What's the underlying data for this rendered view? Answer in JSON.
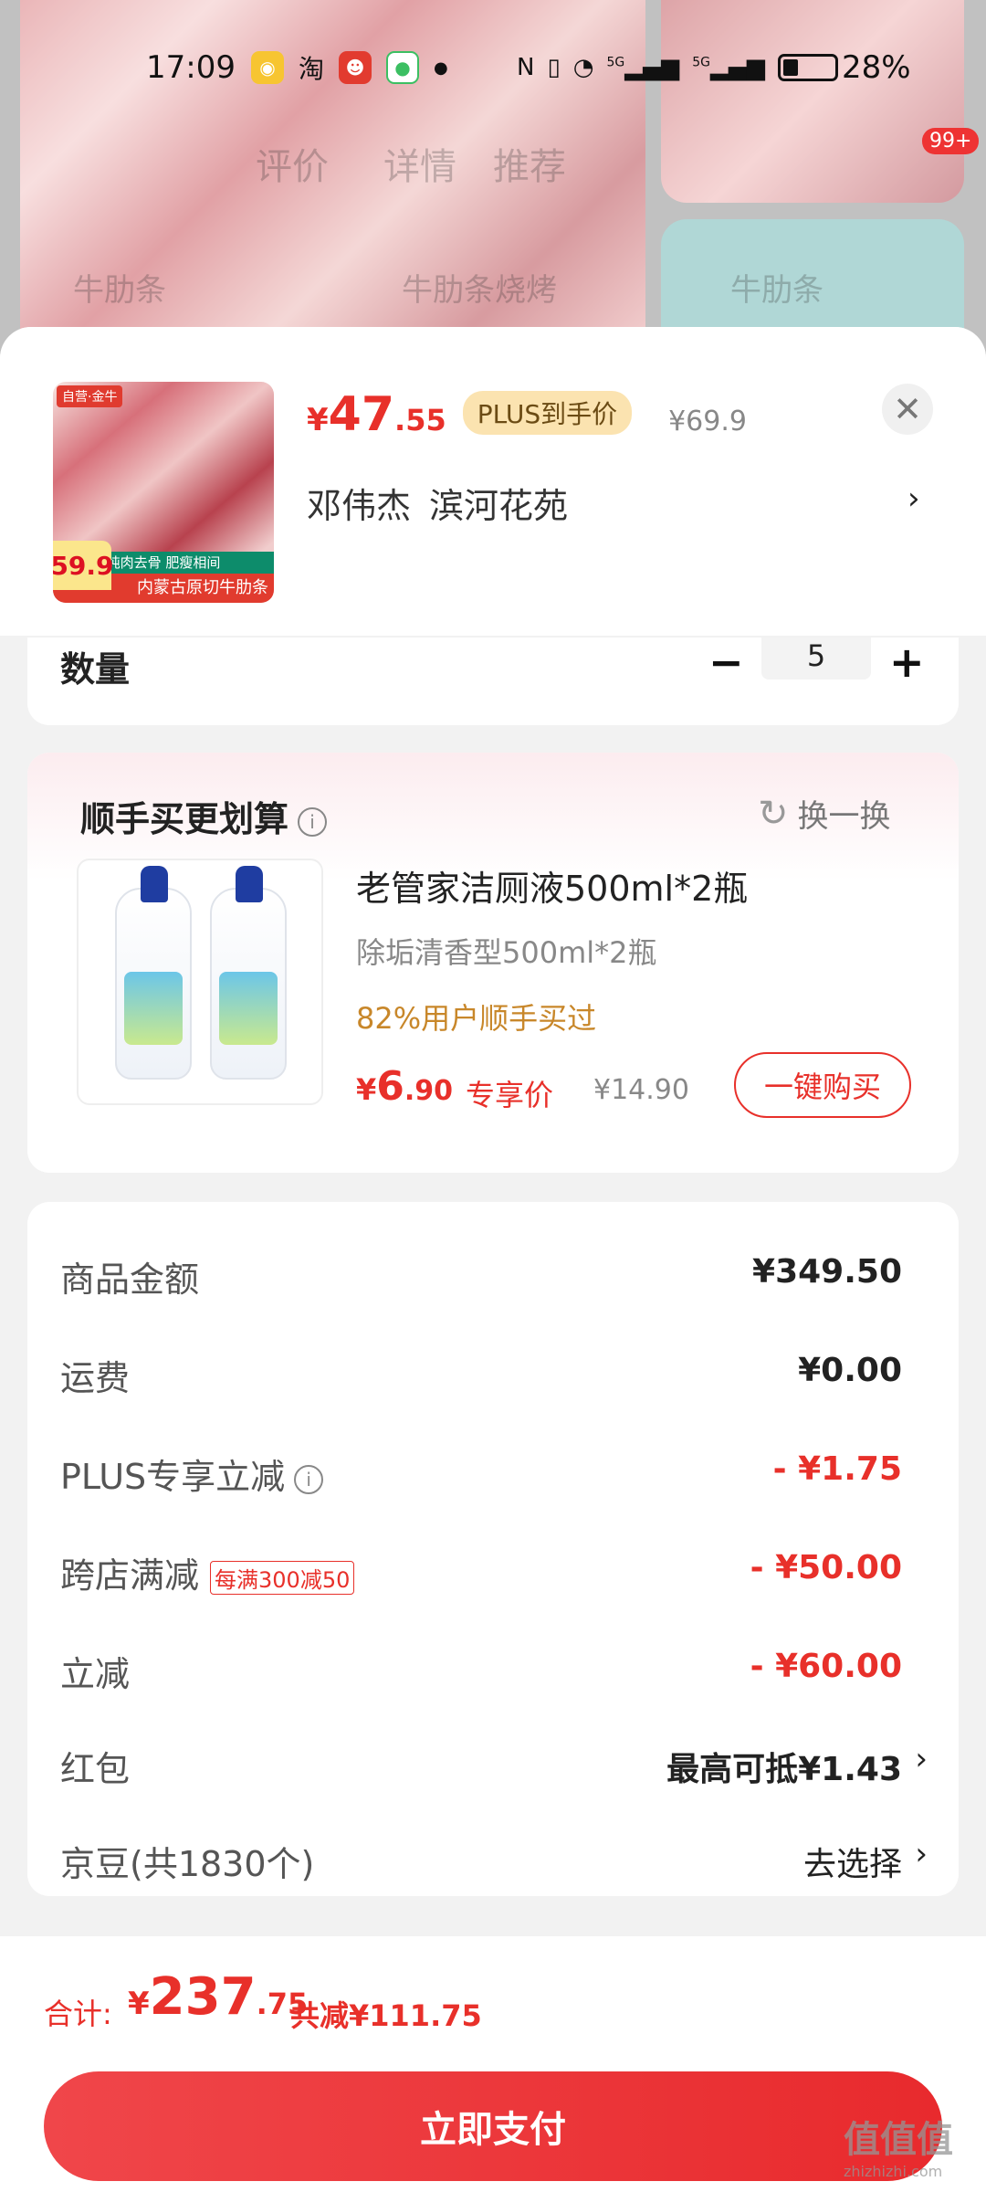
{
  "status_bar": {
    "time": "17:09",
    "app_taobao": "淘",
    "battery_pct": "28%",
    "net1": "5G",
    "net2": "5G"
  },
  "background": {
    "badge": "99+",
    "ghost_tabs": [
      "评价",
      "详情",
      "推荐"
    ],
    "ghost_labels": [
      "牛肋条",
      "牛肋条烧烤",
      "牛肋条"
    ]
  },
  "product": {
    "img_badge": "自营·金牛",
    "img_strip": "纯肉去骨 肥瘦相间",
    "img_strip2": "内蒙古原切牛肋条",
    "img_price": "59.9",
    "price_yen": "¥",
    "price_int": "47",
    "price_dec": ".55",
    "plus_label": "PLUS到手价",
    "orig_price": "¥69.9",
    "addr_name": "邓伟杰",
    "addr_place": "滨河花苑"
  },
  "quantity": {
    "label": "数量",
    "minus": "−",
    "plus": "+",
    "value": "5"
  },
  "bundle": {
    "title": "顺手买更划算",
    "swap": "换一换",
    "name": "老管家洁厕液500ml*2瓶",
    "spec": "除垢清香型500ml*2瓶",
    "rate": "82%用户顺手买过",
    "price_yen": "¥",
    "price_int": "6",
    "price_dec": ".90",
    "exclusive": "专享价",
    "orig_price": "¥14.90",
    "buy": "一键购买"
  },
  "summary": {
    "rows": [
      {
        "k": "商品金额",
        "v": "¥349.50"
      },
      {
        "k": "运费",
        "v": "¥0.00"
      },
      {
        "k": "PLUS专享立减",
        "v": "- ¥1.75"
      },
      {
        "k": "跨店满减",
        "tag": "每满300减50",
        "v": "- ¥50.00"
      },
      {
        "k": "立减",
        "v": "- ¥60.00"
      },
      {
        "k": "红包",
        "v": "最高可抵¥1.43"
      },
      {
        "k": "京豆(共1830个)",
        "v": "去选择"
      }
    ]
  },
  "footer": {
    "total_label": "合计:",
    "total_yen": "¥",
    "total_int": "237",
    "total_dec": ".75",
    "saved": "共减¥111.75",
    "pay": "立即支付"
  },
  "watermark": {
    "text": "值值值",
    "sub": "zhizhizhi.com"
  },
  "colors": {
    "accent": "#e8302a",
    "plus_pill": "#fbe3b0",
    "rate": "#c8872a"
  },
  "icons": [
    "close-icon",
    "chevron-right-icon",
    "info-icon",
    "refresh-icon",
    "minus-icon",
    "plus-icon"
  ]
}
